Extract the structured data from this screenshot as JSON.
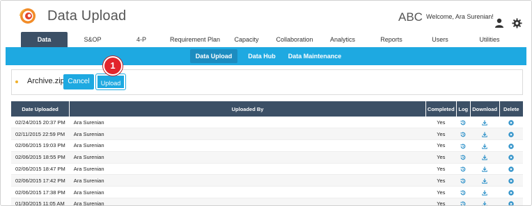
{
  "header": {
    "title": "Data Upload",
    "org": "ABC",
    "welcome": "Welcome, Ara Surenian!"
  },
  "main_nav": [
    {
      "label": "Data",
      "active": true
    },
    {
      "label": "S&OP"
    },
    {
      "label": "4-P"
    },
    {
      "label": "Requirement Plan"
    },
    {
      "label": "Capacity"
    },
    {
      "label": "Collaboration"
    },
    {
      "label": "Analytics"
    },
    {
      "label": "Reports"
    },
    {
      "label": "Users"
    },
    {
      "label": "Utilities"
    }
  ],
  "sub_nav": [
    {
      "label": "Data Upload",
      "active": true
    },
    {
      "label": "Data Hub"
    },
    {
      "label": "Data Maintenance"
    }
  ],
  "upload": {
    "filename": "Archive.zip",
    "cancel_label": "Cancel",
    "upload_label": "Upload",
    "callout": "1"
  },
  "table": {
    "headers": [
      "Date Uploaded",
      "Uploaded By",
      "Completed",
      "Log",
      "Download",
      "Delete"
    ],
    "rows": [
      {
        "date": "02/24/2015 20:37 PM",
        "by": "Ara Surenian",
        "completed": "Yes"
      },
      {
        "date": "02/11/2015 22:59 PM",
        "by": "Ara Surenian",
        "completed": "Yes"
      },
      {
        "date": "02/06/2015 19:03 PM",
        "by": "Ara Surenian",
        "completed": "Yes"
      },
      {
        "date": "02/06/2015 18:55 PM",
        "by": "Ara Surenian",
        "completed": "Yes"
      },
      {
        "date": "02/06/2015 18:47 PM",
        "by": "Ara Surenian",
        "completed": "Yes"
      },
      {
        "date": "02/06/2015 17:42 PM",
        "by": "Ara Surenian",
        "completed": "Yes"
      },
      {
        "date": "02/06/2015 17:38 PM",
        "by": "Ara Surenian",
        "completed": "Yes"
      },
      {
        "date": "01/30/2015 11:05 AM",
        "by": "Ara Surenian",
        "completed": "Yes"
      }
    ]
  },
  "colors": {
    "nav_dark": "#3c5066",
    "accent": "#1ea9e1",
    "callout": "#e2252b"
  }
}
